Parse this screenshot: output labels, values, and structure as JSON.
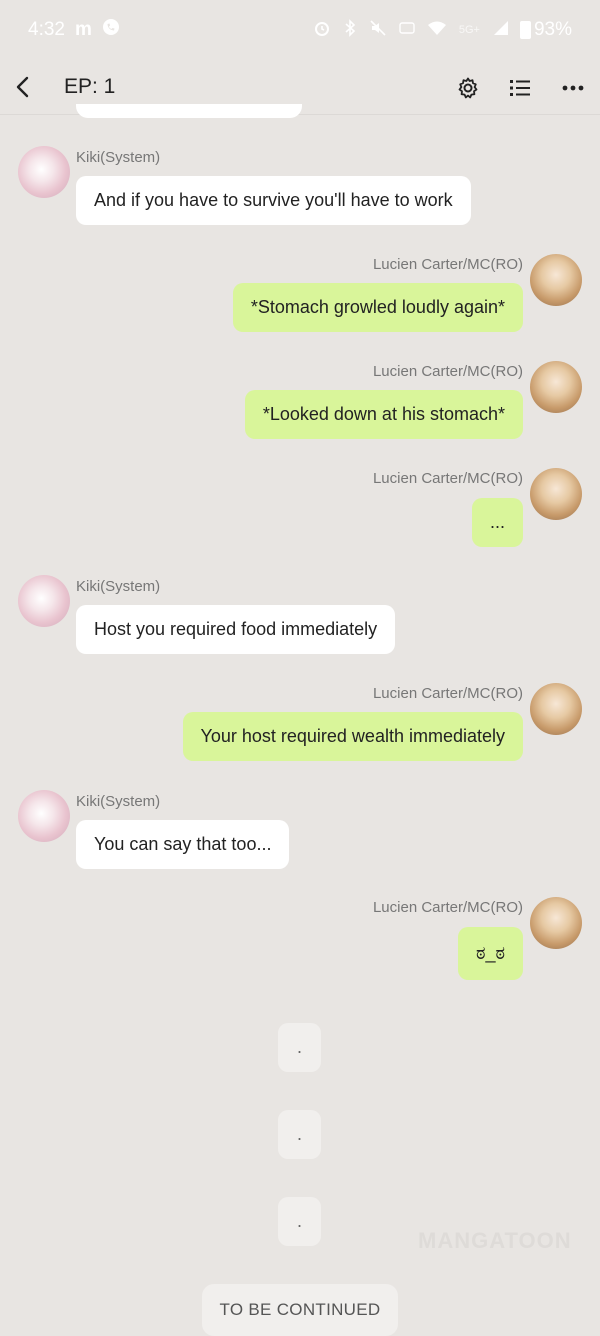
{
  "status_bar": {
    "time": "4:32",
    "battery": "93%"
  },
  "header": {
    "title": "EP: 1"
  },
  "messages": [
    {
      "sender": "Kiki(System)",
      "text": "And if you have to survive you'll have to work",
      "side": "left"
    },
    {
      "sender": "Lucien Carter/MC(RO)",
      "text": "*Stomach growled loudly again*",
      "side": "right"
    },
    {
      "sender": "Lucien Carter/MC(RO)",
      "text": "*Looked down at his stomach*",
      "side": "right"
    },
    {
      "sender": "Lucien Carter/MC(RO)",
      "text": "...",
      "side": "right"
    },
    {
      "sender": "Kiki(System)",
      "text": "Host you required food immediately",
      "side": "left"
    },
    {
      "sender": "Lucien Carter/MC(RO)",
      "text": "Your host required wealth immediately",
      "side": "right"
    },
    {
      "sender": "Kiki(System)",
      "text": "You can say that too...",
      "side": "left"
    },
    {
      "sender": "Lucien Carter/MC(RO)",
      "text": "ಠ_ಠ",
      "side": "right"
    }
  ],
  "separators": [
    ".",
    ".",
    "."
  ],
  "watermark": "MANGATOON",
  "footer": {
    "to_be_continued": "TO BE CONTINUED"
  },
  "colors": {
    "background": "#e8e5e2",
    "bubble_left": "#ffffff",
    "bubble_right": "#d9f59a"
  }
}
